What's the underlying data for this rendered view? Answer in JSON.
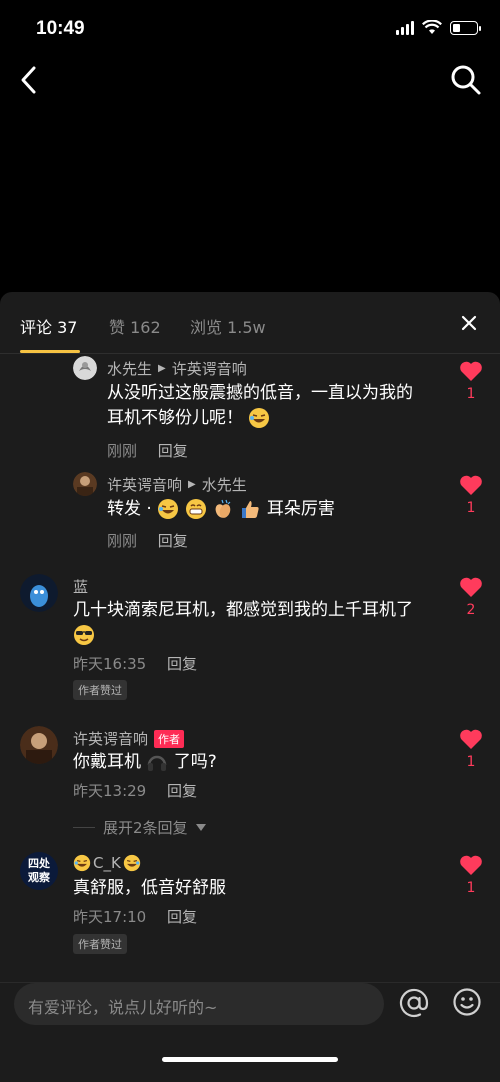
{
  "status": {
    "time": "10:49"
  },
  "tabs": [
    {
      "label": "评论 37"
    },
    {
      "label": "赞 162"
    },
    {
      "label": "浏览 1.5w"
    }
  ],
  "comments": [
    {
      "author": "水先生",
      "reply_to": "许英谔音响",
      "text_line1": "从没听过这般震撼的低音，一直以为我的",
      "text_line2": "耳机不够份儿呢！",
      "time": "刚刚",
      "reply_label": "回复",
      "likes": "1"
    },
    {
      "author": "许英谔音响",
      "reply_to": "水先生",
      "text_prefix": "转发 · ",
      "text_suffix": "耳朵厉害",
      "time": "刚刚",
      "reply_label": "回复",
      "likes": "1"
    },
    {
      "author": "蓝",
      "text_line1": "几十块滴索尼耳机，都感觉到我的上千耳机了",
      "time": "昨天16:35",
      "reply_label": "回复",
      "badge": "作者赞过",
      "likes": "2"
    },
    {
      "author": "许英谔音响",
      "author_tag": "作者",
      "text_prefix": "你戴耳机",
      "text_suffix": "了吗?",
      "time": "昨天13:29",
      "reply_label": "回复",
      "likes": "1"
    },
    {
      "author": "C_K",
      "avatar_text_top": "四处",
      "avatar_text_bottom": "观察",
      "text_line1": "真舒服，低音好舒服",
      "time": "昨天17:10",
      "reply_label": "回复",
      "badge": "作者赞过",
      "likes": "1"
    }
  ],
  "expand_label": "展开2条回复",
  "input": {
    "placeholder": "有爱评论，说点儿好听的~"
  },
  "colors": {
    "accent": "#f6c343",
    "like": "#ff3b5c",
    "sheet": "#1c1c1c"
  }
}
